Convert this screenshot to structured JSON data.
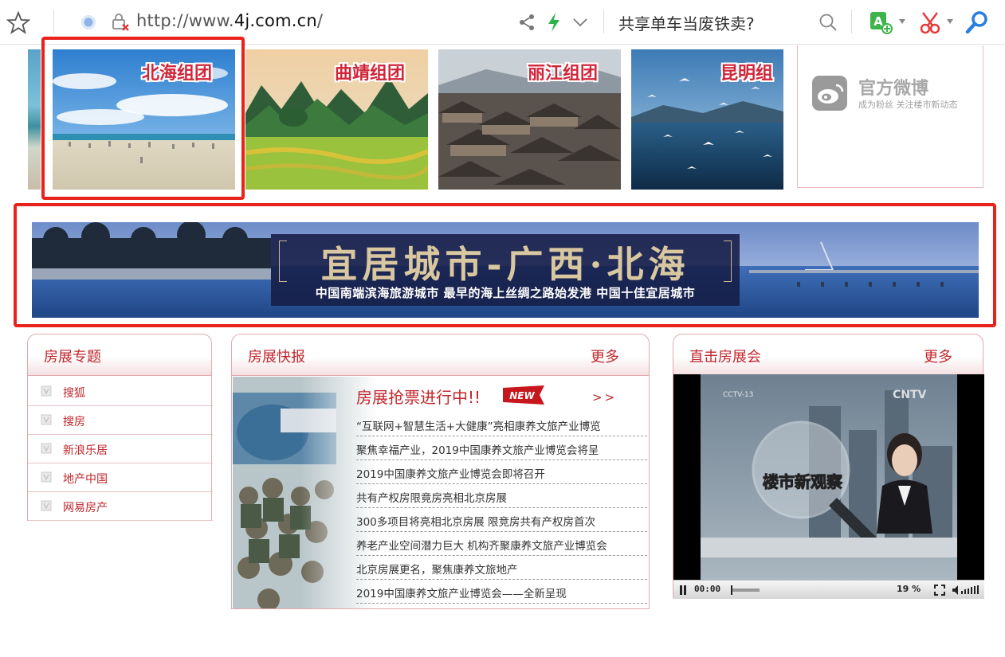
{
  "browser": {
    "url_prefix": "http://www.",
    "url_domain": "4j.com.cn",
    "url_suffix": "/",
    "search_text": "共享单车当废铁卖?"
  },
  "tiles": [
    {
      "label": "北海组团"
    },
    {
      "label": "曲靖组团"
    },
    {
      "label": "丽江组团"
    },
    {
      "label": "昆明组"
    }
  ],
  "weibo": {
    "title": "官方微博",
    "subtitle": "成为粉丝 关注楼市新动态"
  },
  "banner": {
    "title": "宜居城市-广西·北海",
    "subtitle": "中国南端滨海旅游城市  最早的海上丝绸之路始发港  中国十佳宜居城市"
  },
  "topics": {
    "title": "房展专题",
    "items": [
      "搜狐",
      "搜房",
      "新浪乐居",
      "地产中国",
      "网易房产"
    ]
  },
  "news": {
    "title": "房展快报",
    "more": "更多",
    "headline": "房展抢票进行中!!",
    "new_badge": "NEW",
    "arrows": ">>",
    "items": [
      "“互联网+智慧生活+大健康”亮相康养文旅产业博览",
      "聚焦幸福产业，2019中国康养文旅产业博览会将呈",
      "2019中国康养文旅产业博览会即将召开",
      "共有产权房限竟房亮相北京房展",
      "300多项目将亮相北京房展 限竞房共有产权房首次",
      "养老产业空间潜力巨大 机构齐聚康养文旅产业博览会",
      "北京房展更名，聚焦康养文旅地产",
      "2019中国康养文旅产业博览会——全新呈现"
    ]
  },
  "video": {
    "title": "直击房展会",
    "more": "更多",
    "channel_logo": "CNTV",
    "channel_badge": "CCTV-13",
    "program_title": "楼市新观察",
    "time": "00:00",
    "volume": "19 %"
  },
  "colors": {
    "accent_red": "#c0272d",
    "highlight_red": "#e8231b",
    "box_border": "#e1a9ae"
  },
  "icons": [
    "star-icon",
    "secure-icon",
    "lock-warning-icon",
    "share-icon",
    "bolt-icon",
    "chevron-down-icon",
    "search-icon",
    "translate-icon",
    "scissors-icon",
    "find-icon",
    "weibo-icon",
    "new-badge-icon",
    "pause-icon",
    "fullscreen-icon",
    "speaker-icon"
  ]
}
